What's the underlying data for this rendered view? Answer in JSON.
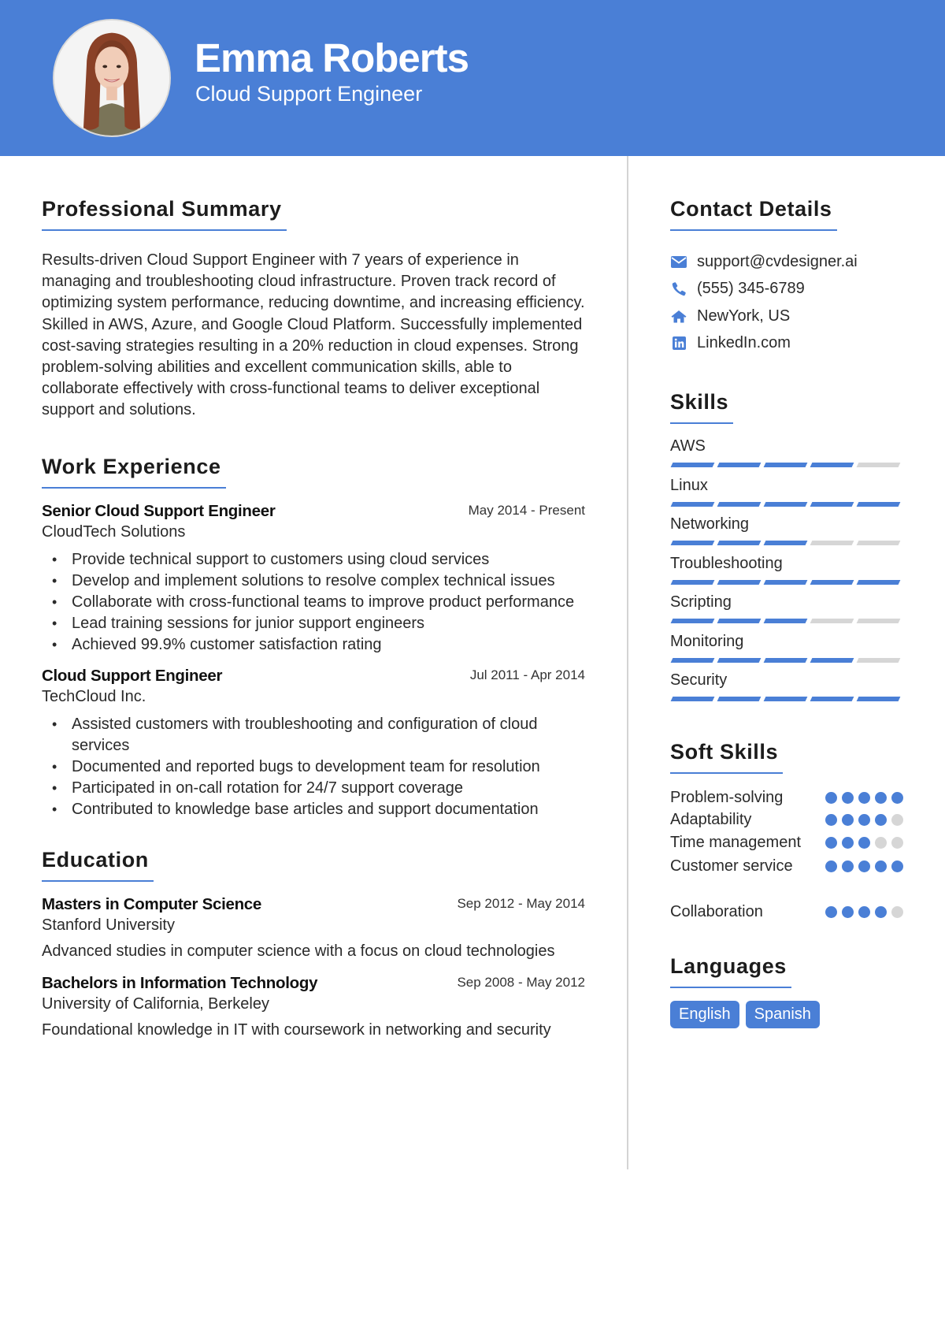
{
  "header": {
    "name": "Emma Roberts",
    "title": "Cloud Support Engineer",
    "accent_color": "#4a7fd6"
  },
  "summary": {
    "heading": "Professional Summary",
    "text": "Results-driven Cloud Support Engineer with 7 years of experience in managing and troubleshooting cloud infrastructure. Proven track record of optimizing system performance, reducing downtime, and increasing efficiency. Skilled in AWS, Azure, and Google Cloud Platform. Successfully implemented cost-saving strategies resulting in a 20% reduction in cloud expenses. Strong problem-solving abilities and excellent communication skills, able to collaborate effectively with cross-functional teams to deliver exceptional support and solutions."
  },
  "experience": {
    "heading": "Work Experience",
    "jobs": [
      {
        "title": "Senior Cloud Support Engineer",
        "dates": "May 2014 - Present",
        "company": "CloudTech Solutions",
        "bullets": [
          "Provide technical support to customers using cloud services",
          "Develop and implement solutions to resolve complex technical issues",
          "Collaborate with cross-functional teams to improve product performance",
          "Lead training sessions for junior support engineers",
          "Achieved 99.9% customer satisfaction rating"
        ]
      },
      {
        "title": "Cloud Support Engineer",
        "dates": "Jul 2011 - Apr 2014",
        "company": "TechCloud Inc.",
        "bullets": [
          "Assisted customers with troubleshooting and configuration of cloud services",
          "Documented and reported bugs to development team for resolution",
          "Participated in on-call rotation for 24/7 support coverage",
          "Contributed to knowledge base articles and support documentation"
        ]
      }
    ]
  },
  "education": {
    "heading": "Education",
    "items": [
      {
        "degree": "Masters in Computer Science",
        "dates": "Sep 2012 - May 2014",
        "school": "Stanford University",
        "description": "Advanced studies in computer science with a focus on cloud technologies"
      },
      {
        "degree": "Bachelors in Information Technology",
        "dates": "Sep 2008 - May 2012",
        "school": "University of California, Berkeley",
        "description": "Foundational knowledge in IT with coursework in networking and security"
      }
    ]
  },
  "contact": {
    "heading": "Contact Details",
    "items": [
      {
        "icon": "envelope-icon",
        "text": "support@cvdesigner.ai"
      },
      {
        "icon": "phone-icon",
        "text": "(555) 345-6789"
      },
      {
        "icon": "home-icon",
        "text": "NewYork, US"
      },
      {
        "icon": "linkedin-icon",
        "text": "LinkedIn.com"
      }
    ]
  },
  "skills": {
    "heading": "Skills",
    "max": 5,
    "items": [
      {
        "name": "AWS",
        "level": 4
      },
      {
        "name": "Linux",
        "level": 5
      },
      {
        "name": "Networking",
        "level": 3
      },
      {
        "name": "Troubleshooting",
        "level": 5
      },
      {
        "name": "Scripting",
        "level": 3
      },
      {
        "name": "Monitoring",
        "level": 4
      },
      {
        "name": "Security",
        "level": 5
      }
    ]
  },
  "soft_skills": {
    "heading": "Soft Skills",
    "max": 5,
    "items": [
      {
        "name": "Problem-solving",
        "level": 5
      },
      {
        "name": "Adaptability",
        "level": 4
      },
      {
        "name": "Time management",
        "level": 3
      },
      {
        "name": "Customer service",
        "level": 5
      },
      {
        "name": "Collaboration",
        "level": 4
      }
    ]
  },
  "languages": {
    "heading": "Languages",
    "items": [
      "English",
      "Spanish"
    ]
  }
}
